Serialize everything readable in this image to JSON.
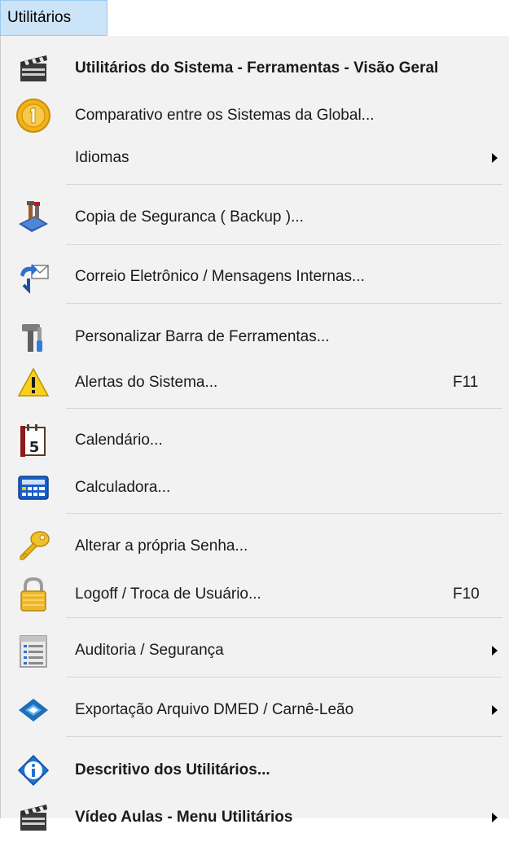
{
  "menubar": {
    "title": "Utilitários"
  },
  "menu": {
    "items": [
      {
        "label": "Utilitários do Sistema - Ferramentas - Visão Geral",
        "icon": "clapperboard-icon",
        "bold": true
      },
      {
        "label": "Comparativo entre os Sistemas da Global...",
        "icon": "gold-coin-one-icon"
      },
      {
        "label": "Idiomas",
        "icon": "none",
        "submenu": true
      },
      {
        "label": "Copia de Seguranca ( Backup )...",
        "icon": "backup-tools-icon"
      },
      {
        "label": "Correio Eletrônico / Mensagens Internas...",
        "icon": "mail-exchange-icon"
      },
      {
        "label": "Personalizar Barra de Ferramentas...",
        "icon": "wrench-screwdriver-icon"
      },
      {
        "label": "Alertas do Sistema...",
        "icon": "warning-icon",
        "shortcut": "F11"
      },
      {
        "label": "Calendário...",
        "icon": "calendar-icon",
        "calendar_day": "5"
      },
      {
        "label": "Calculadora...",
        "icon": "calculator-icon"
      },
      {
        "label": "Alterar a própria Senha...",
        "icon": "key-icon"
      },
      {
        "label": "Logoff / Troca de Usuário...",
        "icon": "padlock-icon",
        "shortcut": "F10"
      },
      {
        "label": "Auditoria / Segurança",
        "icon": "audit-list-icon",
        "submenu": true
      },
      {
        "label": "Exportação Arquivo DMED / Carnê-Leão",
        "icon": "diamond-arrow-icon",
        "submenu": true
      },
      {
        "label": "Descritivo dos Utilitários...",
        "icon": "info-icon",
        "bold": true
      },
      {
        "label": "Vídeo Aulas - Menu Utilitários",
        "icon": "clapperboard-icon",
        "bold": true,
        "submenu": true
      }
    ]
  },
  "colors": {
    "menubar_highlight": "#cce4f7",
    "menu_background": "#f2f2f2",
    "separator": "#d7d7d7"
  }
}
